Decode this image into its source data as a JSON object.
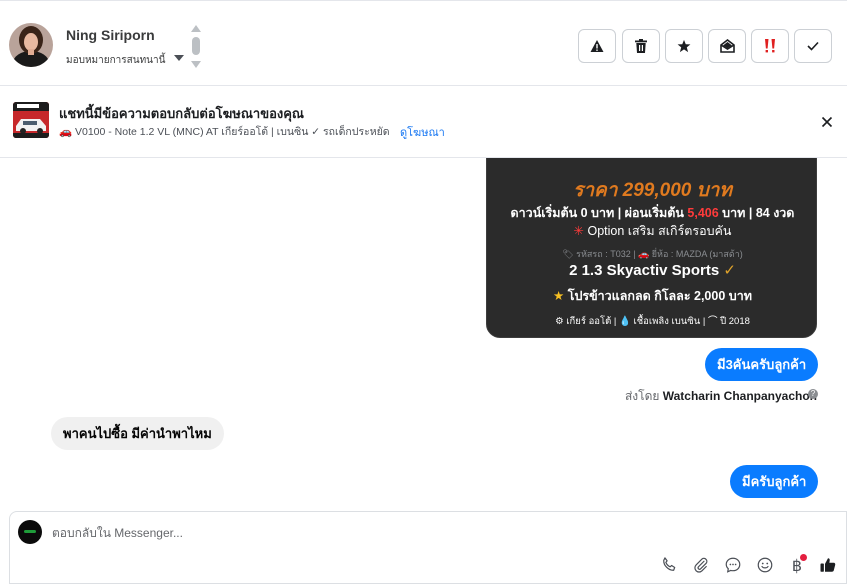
{
  "header": {
    "contact_name": "Ning Siriporn",
    "assign_label": "มอบหมายการสนทนานี้",
    "tools": [
      {
        "name": "mark-spam-button",
        "icon": "warning-icon"
      },
      {
        "name": "delete-button",
        "icon": "trash-icon"
      },
      {
        "name": "star-button",
        "icon": "star-icon"
      },
      {
        "name": "mark-unread-button",
        "icon": "envelope-open-icon"
      },
      {
        "name": "follow-up-button",
        "icon": "double-exclamation-icon"
      },
      {
        "name": "mark-done-button",
        "icon": "check-icon"
      }
    ]
  },
  "ad": {
    "title": "แชทนี้มีข้อความตอบกลับต่อโฆษณาของคุณ",
    "subtitle": "🚗 V0100 - Note 1.2 VL (MNC) AT เกียร์ออโต้ | เบนซิน ✓ รถเด็กประหยัด...",
    "link": "ดูโฆษณา"
  },
  "card": {
    "price": "ราคา 299,000 บาท",
    "down_prefix": "ดาวน์เริ่มต้น 0 บาท | ผ่อนเริ่มต้น ",
    "installment": "5,406",
    "down_suffix": " บาท | 84 งวด",
    "option": "Option เสริม สเกิร์ตรอบคัน",
    "code_line": "🏷 รหัสรถ : T032 | 🚗 ยี่ห้อ : MAZDA (มาสด้า)",
    "model": "2 1.3 Skyactiv Sports",
    "promo": "โปรข้าวแลกลด กิโลละ 2,000 บาท",
    "specs": "⚙ เกียร์ ออโต้   |   💧 เชื้อเพลิง เบนซิน   |   ⌒ ปี 2018"
  },
  "messages": {
    "out1": "มี3คันครับลูกค้า",
    "sent_by_label": "ส่งโดย",
    "sent_by_name": "Watcharin Chanpanyachon",
    "in1": "พาคนไปซื้อ มีค่านำพาไหม",
    "out2": "มีครับลูกค้า"
  },
  "composer": {
    "placeholder": "ตอบกลับใน Messenger...",
    "icons": [
      "phone-icon",
      "paperclip-icon",
      "chat-bubble-icon",
      "smiley-icon",
      "baht-icon",
      "thumbs-up-icon"
    ],
    "baht_symbol": "฿"
  },
  "colors": {
    "accent": "#0a7cff",
    "price_orange": "#e07a1f",
    "card_bg": "#2b2b2b",
    "alert_red": "#e41e3f"
  }
}
